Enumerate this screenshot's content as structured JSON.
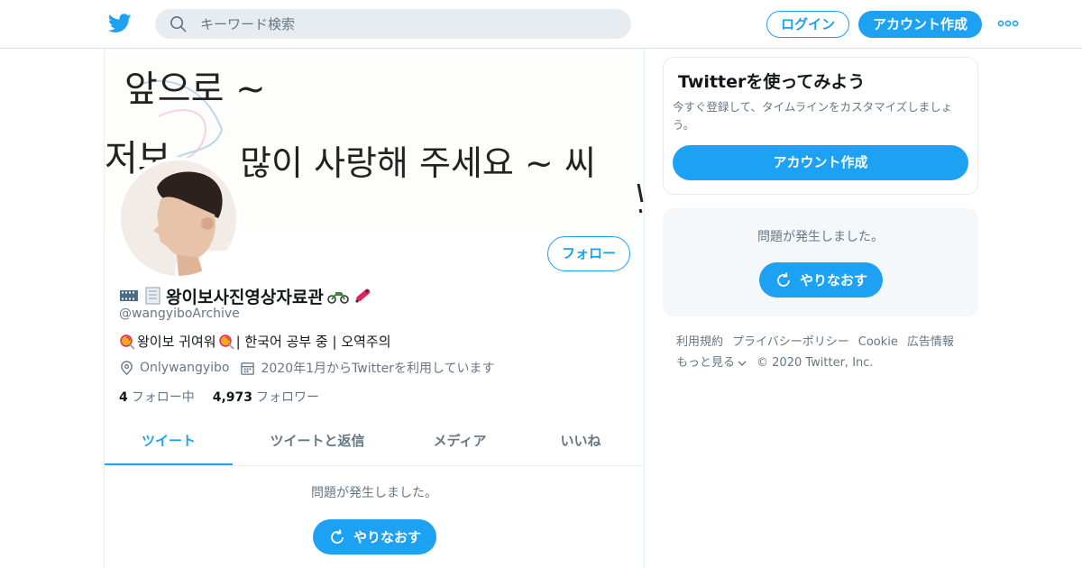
{
  "nav": {
    "search_placeholder": "キーワード検索",
    "login_label": "ログイン",
    "signup_label": "アカウント作成"
  },
  "banner": {
    "handwriting": [
      "앞으로 ~",
      "저보",
      "많이 사랑해 주세요 ~ 씨"
    ]
  },
  "profile": {
    "name": "왕이보사진영상자료관",
    "handle": "@wangyiboArchive",
    "bio_part1": "왕이보 귀여워",
    "bio_part2": "| 한국어 공부 중 | 오역주의",
    "location": "Onlywangyibo",
    "joined": "2020年1月からTwitterを利用しています",
    "following_count": "4",
    "following_label": "フォロー中",
    "followers_count": "4,973",
    "followers_label": "フォロワー",
    "follow_button": "フォロー"
  },
  "tabs": [
    {
      "label": "ツイート",
      "active": true
    },
    {
      "label": "ツイートと返信",
      "active": false
    },
    {
      "label": "メディア",
      "active": false
    },
    {
      "label": "いいね",
      "active": false
    }
  ],
  "timeline": {
    "error_message": "問題が発生しました。",
    "retry_label": "やりなおす"
  },
  "sidebar": {
    "try_title": "Twitterを使ってみよう",
    "try_text": "今すぐ登録して、タイムラインをカスタマイズしましょう。",
    "try_button": "アカウント作成",
    "error_message": "問題が発生しました。",
    "retry_label": "やりなおす"
  },
  "footer": {
    "links": [
      "利用規約",
      "プライバシーポリシー",
      "Cookie",
      "広告情報"
    ],
    "more": "もっと見る",
    "copyright": "© 2020 Twitter, Inc."
  },
  "colors": {
    "accent": "#1da1f2",
    "text": "#14171a",
    "secondary": "#657786",
    "border": "#e6ecf0"
  }
}
